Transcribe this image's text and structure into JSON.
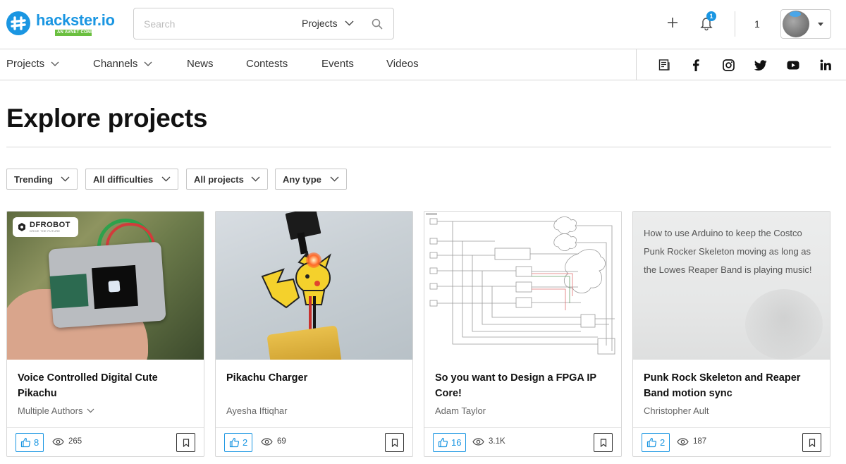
{
  "header": {
    "logo_name": "hackster.io",
    "logo_tagline": "AN AVNET COMMUNITY",
    "search_placeholder": "Search",
    "search_scope": "Projects",
    "notification_count": "1",
    "reputation": "1",
    "brand_color": "#1a96e2"
  },
  "nav": {
    "items": [
      {
        "label": "Projects",
        "has_dropdown": true
      },
      {
        "label": "Channels",
        "has_dropdown": true
      },
      {
        "label": "News"
      },
      {
        "label": "Contests"
      },
      {
        "label": "Events"
      },
      {
        "label": "Videos"
      }
    ],
    "social": [
      "newsletter-icon",
      "facebook-icon",
      "instagram-icon",
      "twitter-icon",
      "youtube-icon",
      "linkedin-icon"
    ]
  },
  "page": {
    "title": "Explore projects"
  },
  "filters": [
    {
      "label": "Trending"
    },
    {
      "label": "All difficulties"
    },
    {
      "label": "All projects"
    },
    {
      "label": "Any type"
    }
  ],
  "cards": [
    {
      "title": "Voice Controlled Digital Cute Pikachu",
      "author": "Multiple Authors",
      "author_dropdown": true,
      "likes": "8",
      "views": "265",
      "image_badge": "DFROBOT",
      "image_badge_sub": "DRIVE THE FUTURE"
    },
    {
      "title": "Pikachu Charger",
      "author": "Ayesha Iftiqhar",
      "likes": "2",
      "views": "69"
    },
    {
      "title": "So you want to Design a FPGA IP Core!",
      "author": "Adam Taylor",
      "likes": "16",
      "views": "3.1K"
    },
    {
      "title": "Punk Rock Skeleton and Reaper Band motion sync",
      "author": "Christopher Ault",
      "likes": "2",
      "views": "187",
      "image_text": "How to use Arduino to keep the Costco Punk Rocker Skeleton moving as long as the Lowes Reaper Band is playing music!"
    }
  ]
}
